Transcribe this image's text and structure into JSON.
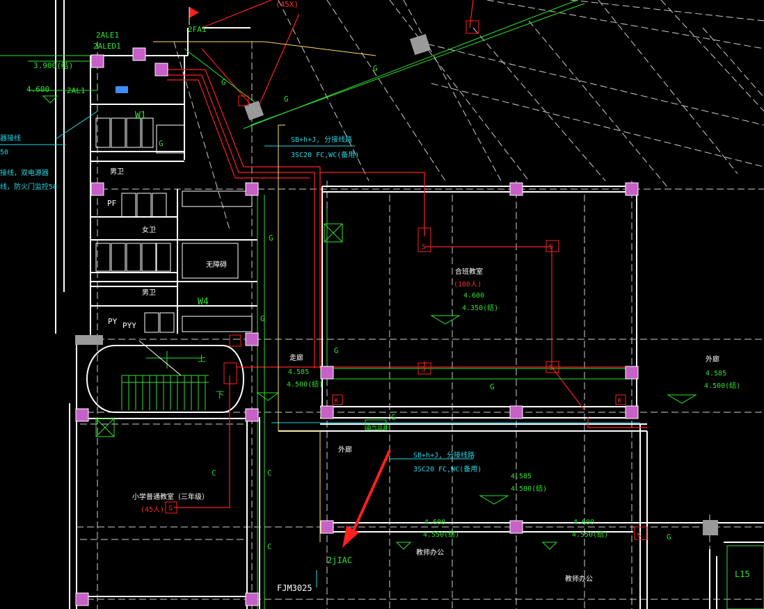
{
  "colors": {
    "background": "#000000",
    "wall": "#ffffff",
    "grid_dashed": "#dcdcdc",
    "column": "#c760c7",
    "cable_red": "#ff2020",
    "line_green": "#2ee32e",
    "text_cyan": "#28d7e6",
    "text_green": "#38e838",
    "text_red": "#ff2b2b",
    "text_white": "#ffffff",
    "cable_yellow": "#ffe35a",
    "cable_blue": "#3f8cff"
  },
  "panels": {
    "top_left": [
      "2ALE1",
      "2ALED1"
    ],
    "al1": "2AL1",
    "fa1": "2FA1",
    "fa1_count": "(45X)",
    "iac": "2jIAC"
  },
  "elevations": {
    "left_a": "3.900(结)",
    "left_b": "4.600"
  },
  "left_notes": [
    "器接线",
    "50",
    "接线，双电源器",
    "线，防火门监控50"
  ],
  "cable_notes": {
    "top_1": "SB+h+J, 分接线路",
    "top_2": "3SC20 FC,WC(备用)",
    "mid_1": "SB+h+J, 分接线路",
    "mid_2": "3SC20 FC,WC(备用)"
  },
  "rooms": {
    "stair_w1": "W1",
    "male_wc": "男卫",
    "female_wc": "女卫",
    "acc_wc": "无障碍",
    "male_wc2": "男卫",
    "pf": "PF",
    "py": "PY",
    "pyy": "PYY",
    "w4": "W4",
    "stair_up": "上",
    "stair_down": "下",
    "corridor": "走廊",
    "outer_corr": "外廊",
    "outer_corr2": "外廊",
    "lecture": "合班教室",
    "lecture_cap": "(180人)",
    "classroom": "小学普通教室（三年级）",
    "classroom_cap": "(45人)",
    "office1": "教师办公",
    "office2": "教师办公",
    "door": "FJM3025",
    "lift": "L15",
    "shaft": "电气竖井"
  },
  "levels": {
    "lecture_a": "4.600",
    "lecture_b": "4.350(结)",
    "corr_a": "4.585",
    "corr_b": "4.500(结)",
    "right_a": "4.585",
    "right_b": "4.500(结)",
    "mid_a": "4.585",
    "mid_b": "4.500(结)",
    "off1_a": "4.600",
    "off1_b": "4.550(结)",
    "off2_a": "4.600",
    "off2_b": "4.550(结)"
  },
  "symbols": {
    "g": "G",
    "s": "S",
    "k": "K",
    "c": "C"
  }
}
